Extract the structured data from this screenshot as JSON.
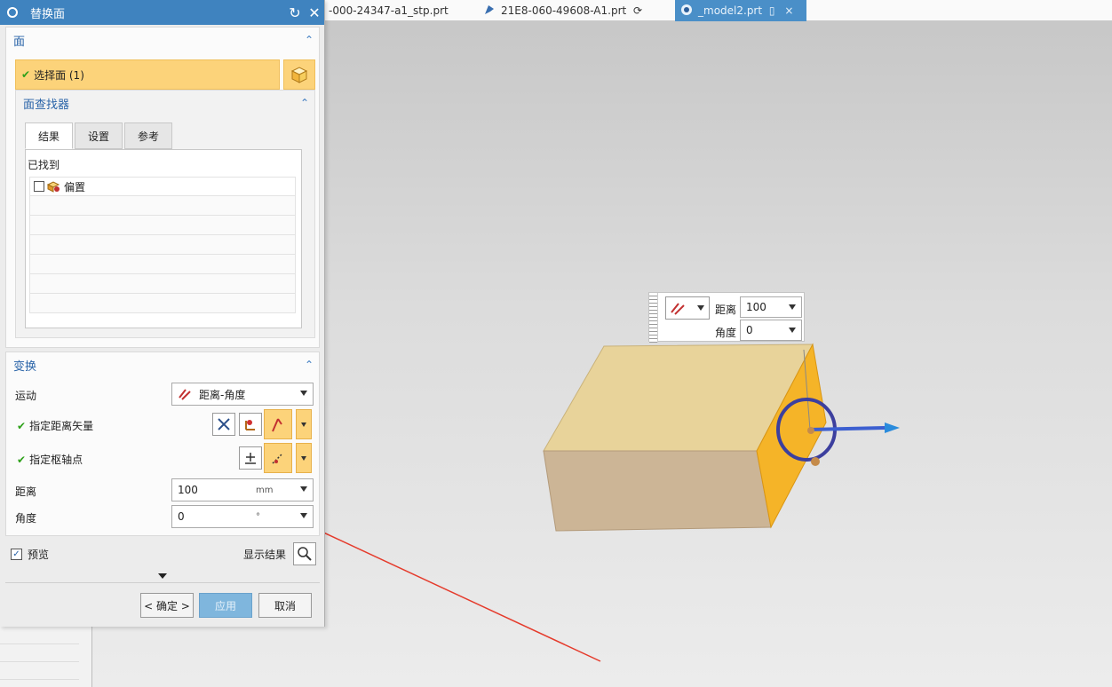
{
  "tabs": [
    {
      "label": "-000-24347-a1_stp.prt",
      "active": false
    },
    {
      "label": "21E8-060-49608-A1.prt",
      "active": false
    },
    {
      "label": "_model2.prt",
      "active": true
    }
  ],
  "dialog": {
    "title": "替换面",
    "face_group": {
      "title": "面",
      "select_label": "选择面 (1)",
      "sub": {
        "title": "面查找器",
        "tabs": [
          "结果",
          "设置",
          "参考"
        ],
        "found_label": "已找到",
        "list_items": [
          "偏置"
        ]
      }
    },
    "transform_group": {
      "title": "变换",
      "motion_label": "运动",
      "motion_value": "距离-角度",
      "vector_label": "指定距离矢量",
      "pivot_label": "指定枢轴点",
      "distance_label": "距离",
      "distance_value": "100",
      "distance_unit": "mm",
      "angle_label": "角度",
      "angle_value": "0",
      "angle_unit": "°"
    },
    "preview_label": "预览",
    "preview_checked": true,
    "show_result_label": "显示结果",
    "buttons": {
      "ok": "< 确定 >",
      "apply": "应用",
      "cancel": "取消"
    }
  },
  "handle_box": {
    "distance_label": "距离",
    "distance_value": "100",
    "angle_label": "角度",
    "angle_value": "0"
  },
  "colors": {
    "accent": "#3f83bf",
    "selection": "#fcd37a",
    "check": "#2ea11a",
    "block_top": "#e8d39a",
    "block_front": "#ccb596",
    "block_side": "#f5b428",
    "annotation": "#e53b2c"
  }
}
